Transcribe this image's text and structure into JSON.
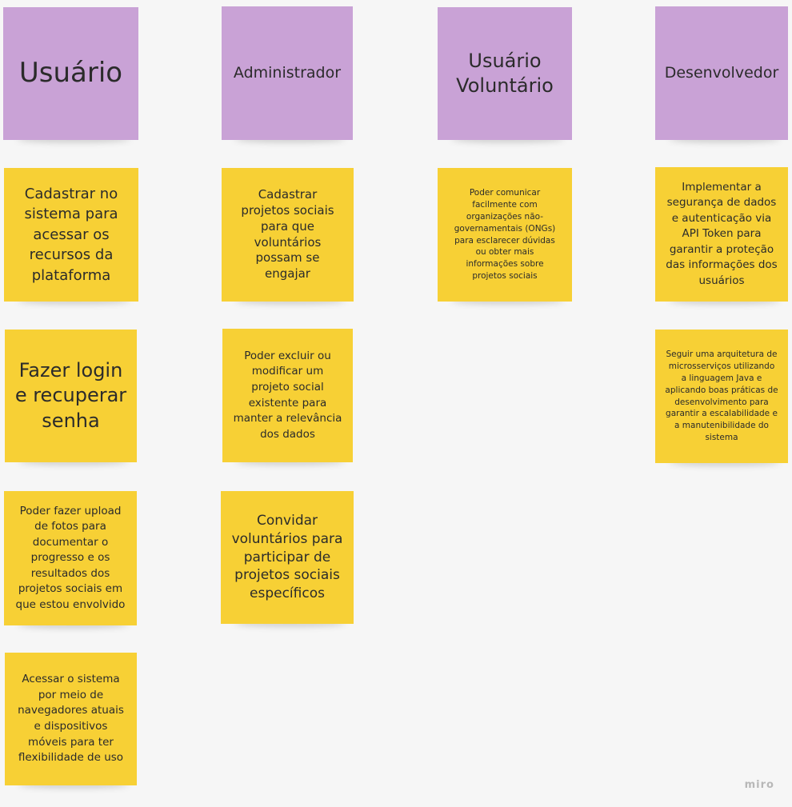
{
  "columns": [
    {
      "header": "Usuário",
      "notes": [
        "Cadastrar no sistema para acessar os recursos da plataforma",
        "Fazer login e recuperar senha",
        "Poder fazer upload de fotos para documentar o progresso e os resultados dos projetos sociais em que estou envolvido",
        "Acessar o sistema por meio de navegadores atuais e dispositivos móveis para ter flexibilidade de uso"
      ]
    },
    {
      "header": "Administrador",
      "notes": [
        "Cadastrar projetos sociais para que voluntários possam se engajar",
        "Poder excluir ou modificar um projeto social existente para manter a relevância dos dados",
        "Convidar voluntários para participar de projetos sociais específicos"
      ]
    },
    {
      "header": "Usuário Voluntário",
      "notes": [
        "Poder comunicar facilmente com organizações não-governamentais (ONGs) para esclarecer dúvidas ou obter mais informações sobre projetos sociais"
      ]
    },
    {
      "header": "Desenvolvedor",
      "notes": [
        "Implementar a segurança de dados e autenticação via API Token para garantir a proteção das informações dos usuários",
        "Seguir uma arquitetura de microsserviços utilizando a linguagem Java e aplicando boas práticas de desenvolvimento para garantir a escalabilidade e a manutenibilidade do sistema"
      ]
    }
  ],
  "watermark": "miro",
  "colors": {
    "header_note": "#c9a2d6",
    "story_note": "#f7d035",
    "board": "#f6f6f6"
  }
}
